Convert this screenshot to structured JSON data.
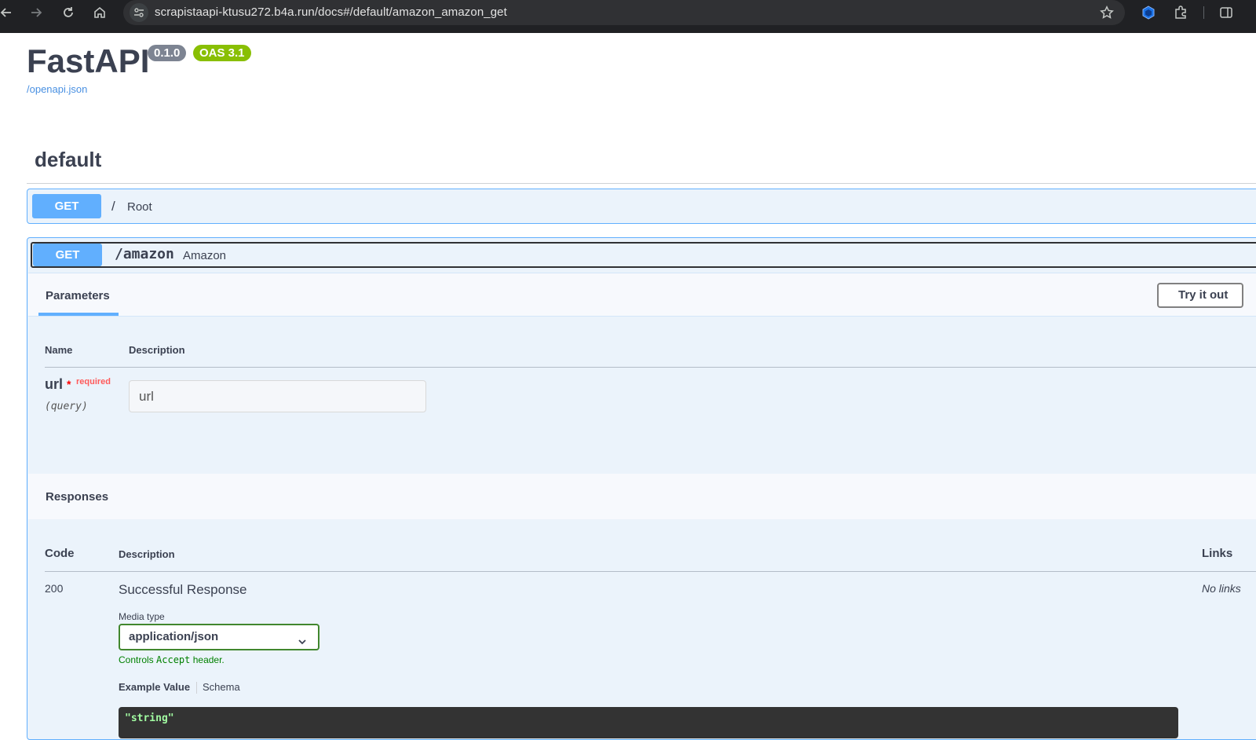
{
  "browser": {
    "url": "scrapistaapi-ktusu272.b4a.run/docs#/default/amazon_amazon_get",
    "icons": [
      "back-icon",
      "forward-icon",
      "reload-icon",
      "home-icon",
      "site-info-icon",
      "bookmark-star-icon",
      "extension-cube-icon",
      "puzzle-icon",
      "side-panel-icon"
    ]
  },
  "info": {
    "title": "FastAPI",
    "version": "0.1.0",
    "oas": "OAS 3.1",
    "spec_link": "/openapi.json"
  },
  "tag": {
    "name": "default"
  },
  "operations": [
    {
      "method": "GET",
      "path": "/",
      "summary": "Root"
    },
    {
      "method": "GET",
      "path": "/amazon",
      "summary": "Amazon"
    }
  ],
  "parameters": {
    "tab": "Parameters",
    "try_it_out": "Try it out",
    "col_name": "Name",
    "col_description": "Description",
    "items": [
      {
        "name": "url",
        "required_star": "*",
        "required_label": "required",
        "in": "(query)",
        "placeholder": "url"
      }
    ]
  },
  "responses": {
    "title": "Responses",
    "col_code": "Code",
    "col_description": "Description",
    "col_links": "Links",
    "items": [
      {
        "code": "200",
        "description": "Successful Response",
        "links": "No links",
        "media_type_label": "Media type",
        "media_type": "application/json",
        "controls_prefix": "Controls ",
        "controls_code": "Accept",
        "controls_suffix": " header.",
        "example_tab": "Example Value",
        "schema_tab": "Schema",
        "example": "\"string\""
      }
    ]
  },
  "colors": {
    "get": "#61affe",
    "opblock_bg": "#ebf3fb",
    "oas_badge": "#89bf04",
    "version_badge": "#7d8492",
    "media_border": "#41872e"
  }
}
